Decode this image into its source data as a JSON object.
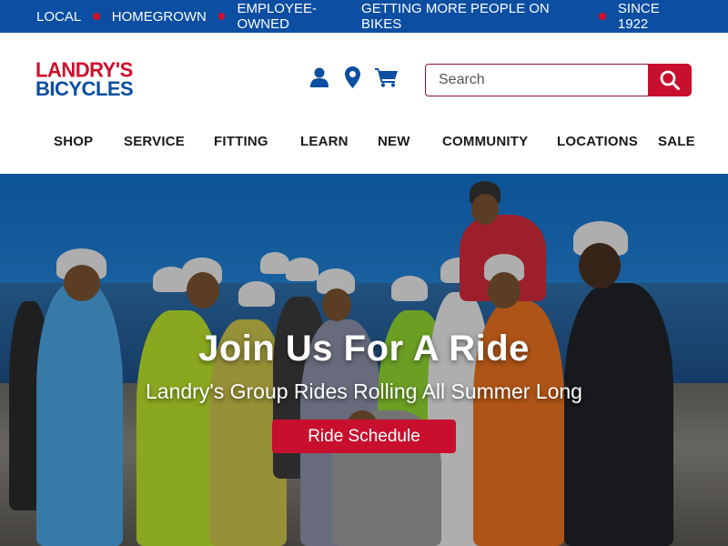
{
  "topbar": {
    "left_items": [
      "LOCAL",
      "HOMEGROWN",
      "EMPLOYEE-OWNED"
    ],
    "right_items": [
      "GETTING MORE PEOPLE ON BIKES",
      "SINCE 1922"
    ],
    "dot_color": "#d0102c",
    "background": "#0b4ea2"
  },
  "logo": {
    "line1": "LANDRY'S",
    "line2": "BICYCLES",
    "line1_color": "#d0102c",
    "line2_color": "#0b4ea2"
  },
  "header_icons": [
    "account-icon",
    "location-pin-icon",
    "cart-icon"
  ],
  "search": {
    "placeholder": "Search",
    "value": "",
    "button_icon": "search-icon",
    "button_color": "#c8102e"
  },
  "nav": {
    "items": [
      {
        "label": "SHOP"
      },
      {
        "label": "SERVICE"
      },
      {
        "label": "FITTING"
      },
      {
        "label": "LEARN"
      },
      {
        "label": "NEW"
      },
      {
        "label": "COMMUNITY"
      },
      {
        "label": "LOCATIONS"
      },
      {
        "label": "SALE"
      }
    ]
  },
  "hero": {
    "title": "Join Us For A Ride",
    "subtitle": "Landry's Group Rides Rolling All Summer Long",
    "button_label": "Ride Schedule",
    "button_color": "#c8102e"
  }
}
